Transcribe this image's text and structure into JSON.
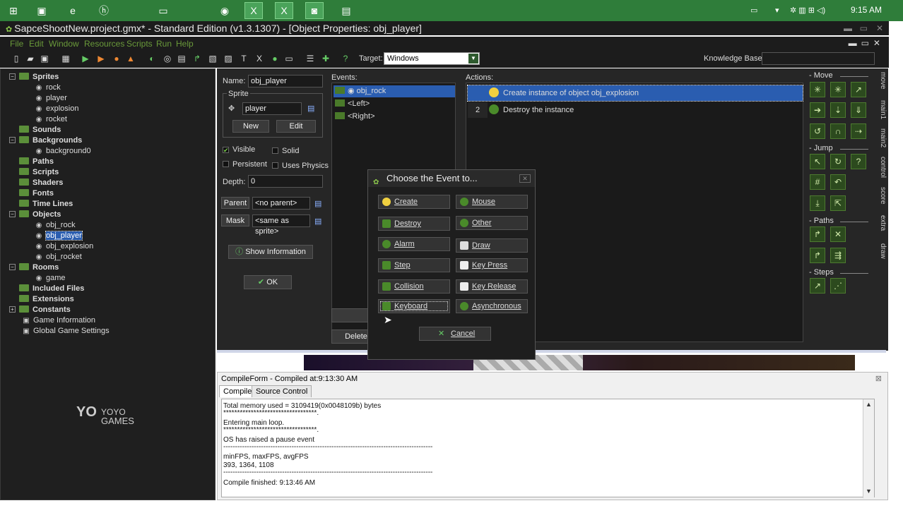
{
  "taskbar": {
    "clock": "9:15 AM"
  },
  "window": {
    "title": "SapceShootNew.project.gmx*  -  Standard Edition (v1.3.1307) - [Object Properties: obj_player]"
  },
  "menu": [
    "File",
    "Edit",
    "Window",
    "Resources",
    "Scripts",
    "Run",
    "Help"
  ],
  "toolbar": {
    "target_label": "Target:",
    "target_value": "Windows",
    "knowledge_base_label": "Knowledge Base:"
  },
  "tree": {
    "items": [
      {
        "label": "Sprites",
        "type": "folder",
        "expand": "−"
      },
      {
        "label": "rock",
        "type": "item"
      },
      {
        "label": "player",
        "type": "item"
      },
      {
        "label": "explosion",
        "type": "item"
      },
      {
        "label": "rocket",
        "type": "item"
      },
      {
        "label": "Sounds",
        "type": "folder"
      },
      {
        "label": "Backgrounds",
        "type": "folder",
        "expand": "−"
      },
      {
        "label": "background0",
        "type": "item"
      },
      {
        "label": "Paths",
        "type": "folder"
      },
      {
        "label": "Scripts",
        "type": "folder"
      },
      {
        "label": "Shaders",
        "type": "folder"
      },
      {
        "label": "Fonts",
        "type": "folder"
      },
      {
        "label": "Time Lines",
        "type": "folder"
      },
      {
        "label": "Objects",
        "type": "folder",
        "expand": "−"
      },
      {
        "label": "obj_rock",
        "type": "item"
      },
      {
        "label": "obj_player",
        "type": "item",
        "selected": true
      },
      {
        "label": "obj_explosion",
        "type": "item"
      },
      {
        "label": "obj_rocket",
        "type": "item"
      },
      {
        "label": "Rooms",
        "type": "folder",
        "expand": "−"
      },
      {
        "label": "game",
        "type": "item"
      },
      {
        "label": "Included Files",
        "type": "folder"
      },
      {
        "label": "Extensions",
        "type": "folder"
      },
      {
        "label": "Constants",
        "type": "folder",
        "expand": "+"
      },
      {
        "label": "Game Information",
        "type": "info"
      },
      {
        "label": "Global Game Settings",
        "type": "info"
      }
    ],
    "logo_line1": "YOYO",
    "logo_line2": "GAMES"
  },
  "props": {
    "name_label": "Name:",
    "name_value": "obj_player",
    "sprite_group": "Sprite",
    "sprite_value": "player",
    "new_button": "New",
    "edit_button": "Edit",
    "visible_label": "Visible",
    "solid_label": "Solid",
    "persistent_label": "Persistent",
    "physics_label": "Uses Physics",
    "depth_label": "Depth:",
    "depth_value": "0",
    "parent_button": "Parent",
    "parent_value": "<no parent>",
    "mask_button": "Mask",
    "mask_value": "<same as sprite>",
    "show_info_button": "Show Information",
    "ok_button": "OK"
  },
  "events": {
    "label": "Events:",
    "items": [
      "obj_rock",
      "<Left>",
      "<Right>"
    ],
    "delete_button": "Delete"
  },
  "actions": {
    "label": "Actions:",
    "items": [
      {
        "num": "",
        "text": "Create instance of object obj_explosion",
        "selected": true
      },
      {
        "num": "2",
        "text": "Destroy the instance",
        "selected": false
      }
    ]
  },
  "library": {
    "sections": [
      "Move",
      "Jump",
      "Paths",
      "Steps"
    ],
    "tabs": [
      "move",
      "main1",
      "main2",
      "control",
      "score",
      "extra",
      "draw"
    ]
  },
  "dialog": {
    "title": "Choose the Event to...",
    "buttons": [
      "Create",
      "Mouse",
      "Destroy",
      "Other",
      "Alarm",
      "Draw",
      "Step",
      "Key Press",
      "Collision",
      "Key Release",
      "Keyboard",
      "Asynchronous"
    ],
    "cancel": "Cancel"
  },
  "compile": {
    "title": "CompileForm - Compiled at:9:13:30 AM",
    "tabs": [
      "Compile",
      "Source Control"
    ],
    "log": [
      "Total memory used = 3109419(0x0048109b) bytes",
      "**********************************.",
      "Entering main loop.",
      "**********************************.",
      "OS has raised a pause event",
      "-----------------------------------------------------------------------------------------",
      "minFPS, maxFPS, avgFPS",
      "393, 1364, 1108",
      "-----------------------------------------------------------------------------------------",
      "Compile finished: 9:13:46 AM"
    ]
  }
}
